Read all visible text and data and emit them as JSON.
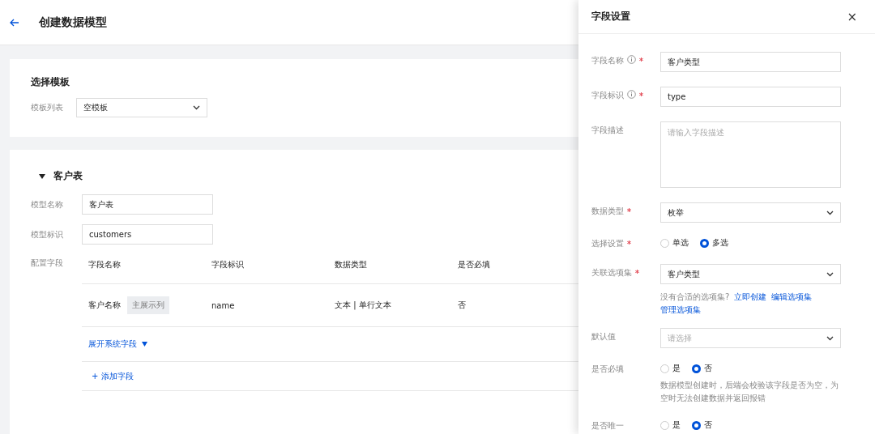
{
  "header": {
    "title": "创建数据模型"
  },
  "template_card": {
    "title": "选择模板",
    "label": "模板列表",
    "value": "空模板"
  },
  "model_card": {
    "title": "客户表",
    "expanded": true,
    "fields": [
      {
        "label": "模型名称",
        "value": "客户表"
      },
      {
        "label": "模型标识",
        "value": "customers"
      }
    ],
    "config_label": "配置字段",
    "table": {
      "columns": [
        "字段名称",
        "字段标识",
        "数据类型",
        "是否必填"
      ],
      "rows": [
        {
          "cells": [
            "客户名称",
            "name",
            "文本 | 单行文本",
            "否"
          ],
          "tag": "主展示列"
        }
      ]
    },
    "expand_link": "展开系统字段",
    "add_link": "+ 添加字段"
  },
  "drawer": {
    "title": "字段设置",
    "close": "×",
    "rows": [
      {
        "kind": "input",
        "label": "字段名称",
        "info": true,
        "required": true,
        "value": "客户类型"
      },
      {
        "kind": "input",
        "label": "字段标识",
        "info": true,
        "required": true,
        "value": "type"
      },
      {
        "kind": "textarea",
        "label": "字段描述",
        "info": false,
        "required": false,
        "placeholder": "请输入字段描述"
      },
      {
        "kind": "select",
        "label": "数据类型",
        "info": false,
        "required": true,
        "value": "枚举"
      },
      {
        "kind": "radio",
        "label": "选择设置",
        "info": false,
        "required": true,
        "options": [
          {
            "label": "单选",
            "selected": false
          },
          {
            "label": "多选",
            "selected": true
          }
        ]
      },
      {
        "kind": "select",
        "label": "关联选项集",
        "info": false,
        "required": true,
        "value": "客户类型",
        "hint": "没有合适的选项集?",
        "links": [
          "立即创建",
          "编辑选项集",
          "管理选项集"
        ]
      },
      {
        "kind": "select",
        "label": "默认值",
        "info": false,
        "required": false,
        "placeholder": "请选择"
      },
      {
        "kind": "radio",
        "label": "是否必填",
        "info": false,
        "required": false,
        "options": [
          {
            "label": "是",
            "selected": false
          },
          {
            "label": "否",
            "selected": true
          }
        ],
        "help": "数据模型创建时，后端会校验该字段是否为空，为空时无法创建数据并返回报错"
      },
      {
        "kind": "radio",
        "label": "是否唯一",
        "info": false,
        "required": false,
        "options": [
          {
            "label": "是",
            "selected": false
          },
          {
            "label": "否",
            "selected": true
          }
        ]
      }
    ]
  }
}
